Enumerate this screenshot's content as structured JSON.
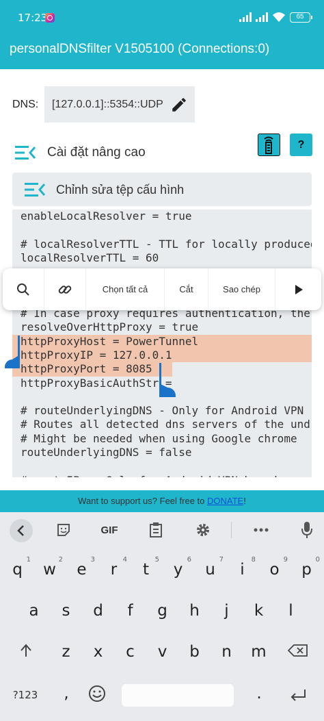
{
  "status_bar": {
    "time": "17:23",
    "battery": "65"
  },
  "app_bar": {
    "title": "personalDNSfilter V1505100 (Connections:0)"
  },
  "dns": {
    "label": "DNS:",
    "value": "[127.0.0.1]::5354::UDP"
  },
  "advanced": {
    "label": "Cài đặt nâng cao",
    "help_label": "?"
  },
  "config_editor": {
    "header_label": "Chỉnh sửa tệp cấu hình",
    "lines": [
      "enableLocalResolver = true",
      "",
      "# localResolverTTL - TTL for locally produced",
      "localResolverTTL = 60",
      "",
      "",
      "",
      "# In case proxy requires authentication, the",
      "resolveOverHttpProxy = true",
      "httpProxyHost = PowerTunnel",
      "httpProxyIP = 127.0.0.1",
      "httpProxyPort = 8085",
      "httpProxyBasicAuthStr =",
      "",
      "# routeUnderlyingDNS - Only for Android VPN",
      "# Routes all detected dns servers of the und",
      "# Might be needed when using Google chrome",
      "routeUnderlyingDNS = false",
      "",
      "# routeIPs - Only for Android VPN based usage"
    ]
  },
  "selection_toolbar": {
    "select_all": "Chọn tất cả",
    "cut": "Cắt",
    "copy": "Sao chép"
  },
  "donate": {
    "text": "Want to support us? Feel free to ",
    "link": "DONATE",
    "suffix": "!"
  },
  "keyboard": {
    "gif_label": "GIF",
    "row1": [
      "q",
      "w",
      "e",
      "r",
      "t",
      "y",
      "u",
      "i",
      "o",
      "p"
    ],
    "row1_hints": [
      "1",
      "2",
      "3",
      "4",
      "5",
      "6",
      "7",
      "8",
      "9",
      "0"
    ],
    "row2": [
      "a",
      "s",
      "d",
      "f",
      "g",
      "h",
      "j",
      "k",
      "l"
    ],
    "row3": [
      "z",
      "x",
      "c",
      "v",
      "b",
      "n",
      "m"
    ],
    "symbols_label": "?123",
    "comma": ",",
    "period": "."
  },
  "colors": {
    "accent": "#1fb6cc",
    "selection": "#f2c6ae",
    "handle": "#1a73c8",
    "link": "#0b4fd8"
  }
}
